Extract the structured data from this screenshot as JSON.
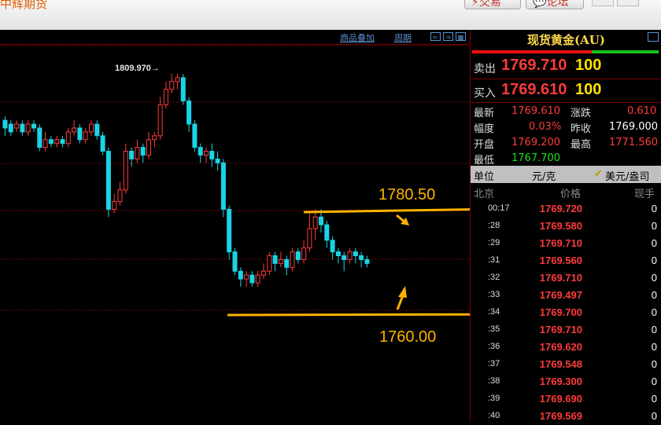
{
  "app": {
    "title": "中辉期货"
  },
  "toolbar": {
    "trade": "⚡交易",
    "forum": "💬论坛"
  },
  "chart_toolbar": {
    "overlay": "商品叠加",
    "period": "周期"
  },
  "annotations": {
    "high_label": "1809.970→",
    "upper_level": "1780.50",
    "lower_level": "1760.00"
  },
  "colors": {
    "candle_up": "#ff3b3b",
    "candle_down": "#19d4e6",
    "arrow": "#ffb300",
    "grid": "#7a0000"
  },
  "panel": {
    "title": "现货黄金(AU)",
    "sell": {
      "label": "卖出",
      "price": "1769.710",
      "volume": "100"
    },
    "buy": {
      "label": "买入",
      "price": "1769.610",
      "volume": "100"
    },
    "stats": {
      "latest_label": "最新",
      "latest": "1769.610",
      "change_label": "涨跌",
      "change": "0.610",
      "range_label": "幅度",
      "range": "0.03%",
      "prev_close_label": "昨收",
      "prev_close": "1769.000",
      "open_label": "开盘",
      "open": "1769.200",
      "high_label": "最高",
      "high": "1771.560",
      "low_label": "最低",
      "low": "1767.700"
    },
    "unit": {
      "label": "单位",
      "value": "元/克",
      "alt": "美元/盎司",
      "alt_checked": true
    },
    "table_header": {
      "time": "北京",
      "price": "价格",
      "volume": "现手"
    },
    "ticks": [
      {
        "time": "00:17",
        "price": "1769.720",
        "volume": "0"
      },
      {
        "time": ":28",
        "price": "1769.580",
        "volume": "0"
      },
      {
        "time": ":29",
        "price": "1769.710",
        "volume": "0"
      },
      {
        "time": ":31",
        "price": "1769.560",
        "volume": "0"
      },
      {
        "time": ":32",
        "price": "1769.710",
        "volume": "0"
      },
      {
        "time": ":33",
        "price": "1769.497",
        "volume": "0"
      },
      {
        "time": ":34",
        "price": "1769.700",
        "volume": "0"
      },
      {
        "time": ":35",
        "price": "1769.710",
        "volume": "0"
      },
      {
        "time": ":36",
        "price": "1769.620",
        "volume": "0"
      },
      {
        "time": ":37",
        "price": "1769.548",
        "volume": "0"
      },
      {
        "time": ":38",
        "price": "1769.300",
        "volume": "0"
      },
      {
        "time": ":39",
        "price": "1769.690",
        "volume": "0"
      },
      {
        "time": ":40",
        "price": "1769.569",
        "volume": "0"
      }
    ]
  },
  "chart_data": {
    "type": "candlestick",
    "candles": [
      [
        1798,
        1796,
        1799,
        1794
      ],
      [
        1797,
        1795,
        1798,
        1794
      ],
      [
        1796,
        1797,
        1798,
        1795
      ],
      [
        1797,
        1795,
        1798,
        1794
      ],
      [
        1795,
        1797,
        1798,
        1794
      ],
      [
        1797,
        1796,
        1798,
        1795
      ],
      [
        1796,
        1791,
        1797,
        1790
      ],
      [
        1791,
        1793,
        1795,
        1790
      ],
      [
        1793,
        1792,
        1794,
        1791
      ],
      [
        1792,
        1793,
        1794,
        1791
      ],
      [
        1793,
        1792,
        1794,
        1791
      ],
      [
        1792,
        1795,
        1796,
        1791
      ],
      [
        1795,
        1796,
        1798,
        1794
      ],
      [
        1796,
        1793,
        1797,
        1792
      ],
      [
        1793,
        1795,
        1796,
        1792
      ],
      [
        1795,
        1797,
        1798,
        1794
      ],
      [
        1797,
        1794,
        1798,
        1793
      ],
      [
        1794,
        1790,
        1795,
        1789
      ],
      [
        1790,
        1775,
        1791,
        1773
      ],
      [
        1775,
        1777,
        1779,
        1774
      ],
      [
        1777,
        1780,
        1782,
        1776
      ],
      [
        1780,
        1790,
        1792,
        1779
      ],
      [
        1790,
        1788,
        1791,
        1786
      ],
      [
        1788,
        1791,
        1793,
        1787
      ],
      [
        1791,
        1789,
        1792,
        1787
      ],
      [
        1789,
        1793,
        1795,
        1788
      ],
      [
        1793,
        1794,
        1795,
        1791
      ],
      [
        1794,
        1802,
        1804,
        1793
      ],
      [
        1802,
        1806,
        1808,
        1801
      ],
      [
        1806,
        1808,
        1810,
        1805
      ],
      [
        1808,
        1809,
        1810,
        1806
      ],
      [
        1809,
        1803,
        1810,
        1802
      ],
      [
        1803,
        1797,
        1804,
        1795
      ],
      [
        1797,
        1791,
        1798,
        1790
      ],
      [
        1791,
        1789,
        1792,
        1787
      ],
      [
        1789,
        1790,
        1791,
        1787
      ],
      [
        1790,
        1788,
        1792,
        1786
      ],
      [
        1788,
        1787,
        1790,
        1785
      ],
      [
        1787,
        1775,
        1788,
        1773
      ],
      [
        1775,
        1764,
        1776,
        1762
      ],
      [
        1764,
        1759,
        1765,
        1758
      ],
      [
        1759,
        1757,
        1760,
        1755
      ],
      [
        1757,
        1758,
        1759,
        1755
      ],
      [
        1758,
        1756,
        1759,
        1755
      ],
      [
        1756,
        1758,
        1759,
        1755
      ],
      [
        1758,
        1759,
        1761,
        1757
      ],
      [
        1759,
        1763,
        1764,
        1758
      ],
      [
        1763,
        1761,
        1764,
        1759
      ],
      [
        1761,
        1762,
        1764,
        1760
      ],
      [
        1762,
        1760,
        1763,
        1758
      ],
      [
        1760,
        1764,
        1765,
        1759
      ],
      [
        1764,
        1762,
        1765,
        1761
      ],
      [
        1762,
        1765,
        1767,
        1761
      ],
      [
        1765,
        1770,
        1774,
        1764
      ],
      [
        1770,
        1773,
        1775,
        1767
      ],
      [
        1773,
        1771,
        1775,
        1769
      ],
      [
        1771,
        1767,
        1772,
        1765
      ],
      [
        1767,
        1764,
        1768,
        1762
      ],
      [
        1764,
        1763,
        1765,
        1761
      ],
      [
        1763,
        1762,
        1764,
        1759
      ],
      [
        1762,
        1764,
        1765,
        1761
      ],
      [
        1764,
        1763,
        1765,
        1761
      ],
      [
        1763,
        1762,
        1764,
        1760
      ],
      [
        1762,
        1761,
        1763,
        1760
      ]
    ]
  }
}
